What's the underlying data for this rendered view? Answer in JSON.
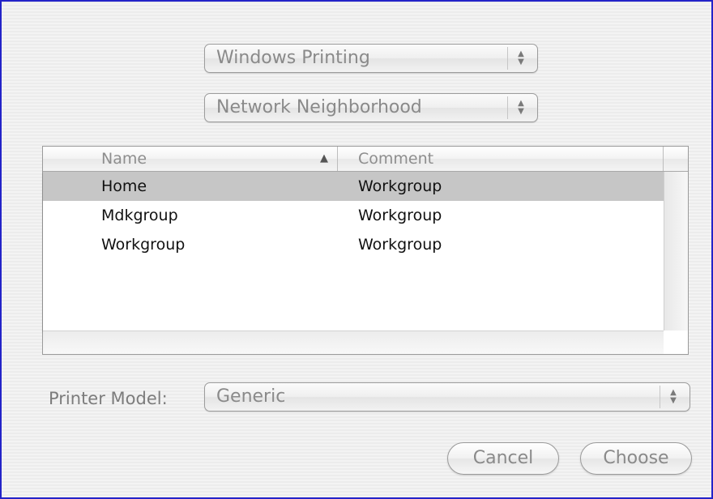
{
  "dialog": {
    "protocol_popup": "Windows Printing",
    "network_popup": "Network Neighborhood",
    "table": {
      "columns": [
        "Name",
        "Comment"
      ],
      "sort_indicator": "▲",
      "rows": [
        {
          "name": "Home",
          "comment": "Workgroup",
          "selected": true
        },
        {
          "name": "Mdkgroup",
          "comment": "Workgroup",
          "selected": false
        },
        {
          "name": "Workgroup",
          "comment": "Workgroup",
          "selected": false
        }
      ]
    },
    "printer_model_label": "Printer Model:",
    "printer_model_value": "Generic",
    "cancel_label": "Cancel",
    "choose_label": "Choose"
  },
  "colors": {
    "border_accent": "#2323c8",
    "selection": "#c6c6c6"
  },
  "icons": {
    "popup_arrows": "up-down-arrows-icon",
    "sort": "sort-ascending-icon"
  }
}
